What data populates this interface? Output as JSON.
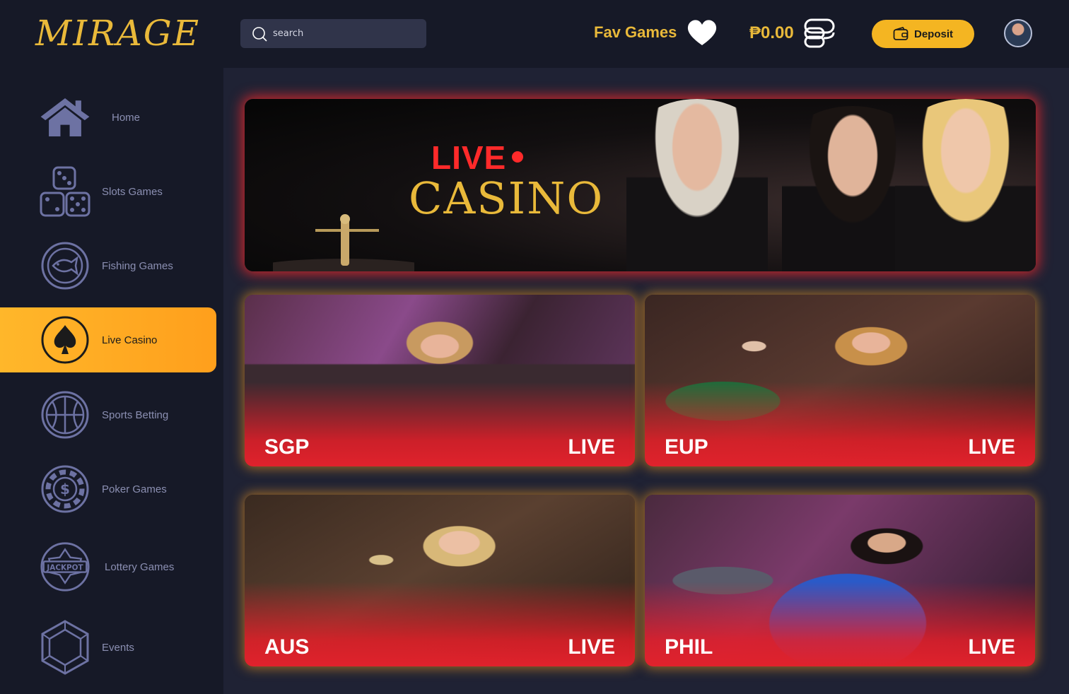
{
  "brand": {
    "logo_text": "MIRAGE",
    "accent": "#e9b93a"
  },
  "header": {
    "search_placeholder": "search",
    "fav_label": "Fav Games",
    "balance": "₱0.00",
    "deposit_label": "Deposit"
  },
  "sidebar": {
    "items": [
      {
        "label": "Home",
        "icon": "home-icon"
      },
      {
        "label": "Slots Games",
        "icon": "dice-icon"
      },
      {
        "label": "Fishing Games",
        "icon": "fish-icon"
      },
      {
        "label": "Live Casino",
        "icon": "spade-icon",
        "active": true
      },
      {
        "label": "Sports Betting",
        "icon": "basketball-icon"
      },
      {
        "label": "Poker Games",
        "icon": "poker-chip-icon"
      },
      {
        "label": "Lottery Games",
        "icon": "jackpot-icon"
      },
      {
        "label": "Events",
        "icon": "hexagon-icon"
      }
    ]
  },
  "banner": {
    "live_text": "LIVE",
    "title": "CASINO"
  },
  "tables": [
    {
      "region": "SGP",
      "status": "LIVE"
    },
    {
      "region": "EUP",
      "status": "LIVE"
    },
    {
      "region": "AUS",
      "status": "LIVE"
    },
    {
      "region": "PHIL",
      "status": "LIVE"
    }
  ],
  "colors": {
    "active_nav": "#ffb72a",
    "deposit_button": "#f4b522",
    "banner_glow": "#ff2828",
    "card_glow": "#ffa01e"
  }
}
